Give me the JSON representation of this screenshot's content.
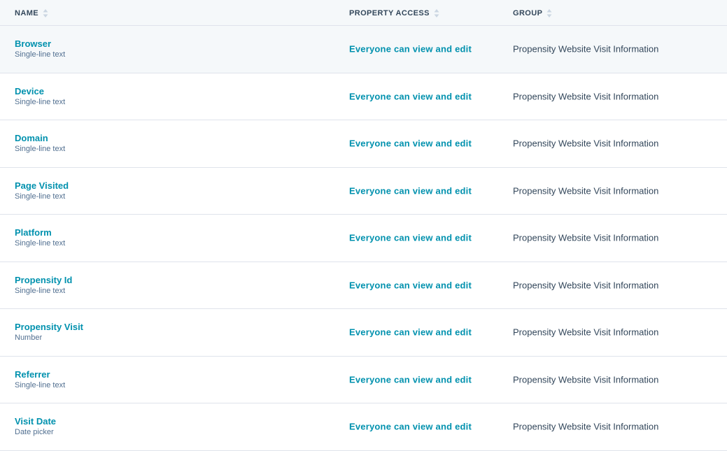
{
  "headers": {
    "name": "NAME",
    "access": "PROPERTY ACCESS",
    "group": "GROUP"
  },
  "rows": [
    {
      "name": "Browser",
      "type": "Single-line text",
      "access": "Everyone can view and edit",
      "group": "Propensity Website Visit Information"
    },
    {
      "name": "Device",
      "type": "Single-line text",
      "access": "Everyone can view and edit",
      "group": "Propensity Website Visit Information"
    },
    {
      "name": "Domain",
      "type": "Single-line text",
      "access": "Everyone can view and edit",
      "group": "Propensity Website Visit Information"
    },
    {
      "name": "Page Visited",
      "type": "Single-line text",
      "access": "Everyone can view and edit",
      "group": "Propensity Website Visit Information"
    },
    {
      "name": "Platform",
      "type": "Single-line text",
      "access": "Everyone can view and edit",
      "group": "Propensity Website Visit Information"
    },
    {
      "name": "Propensity Id",
      "type": "Single-line text",
      "access": "Everyone can view and edit",
      "group": "Propensity Website Visit Information"
    },
    {
      "name": "Propensity Visit",
      "type": "Number",
      "access": "Everyone can view and edit",
      "group": "Propensity Website Visit Information"
    },
    {
      "name": "Referrer",
      "type": "Single-line text",
      "access": "Everyone can view and edit",
      "group": "Propensity Website Visit Information"
    },
    {
      "name": "Visit Date",
      "type": "Date picker",
      "access": "Everyone can view and edit",
      "group": "Propensity Website Visit Information"
    }
  ],
  "colors": {
    "link": "#0091ae",
    "text": "#33475b",
    "muted": "#516f90",
    "header_bg": "#f5f8fa",
    "border": "#dfe3eb"
  },
  "icons": {
    "sort": "sort-icon"
  }
}
